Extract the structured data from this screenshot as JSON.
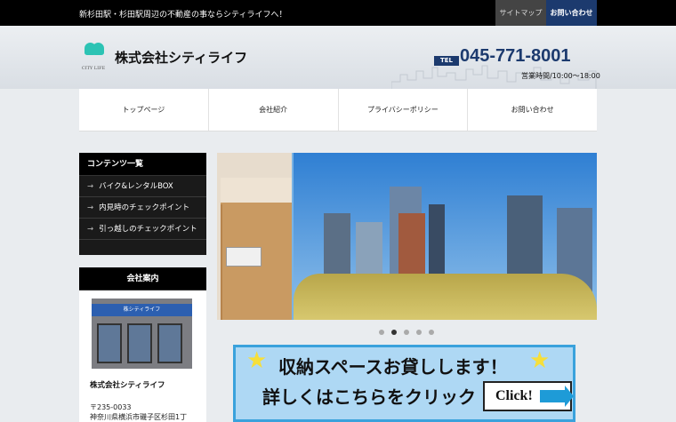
{
  "topbar": {
    "tagline": "新杉田駅・杉田駅周辺の不動産の事ならシティライフへ！",
    "sitemap": "サイトマップ",
    "contact": "お問い合わせ"
  },
  "header": {
    "logo_caption": "CITY LIFE",
    "company": "株式会社シティライフ",
    "tel_label": "TEL",
    "tel": "045-771-8001",
    "hours": "営業時間/10:00～18:00"
  },
  "nav": [
    "トップページ",
    "会社紹介",
    "プライバシーポリシー",
    "お問い合わせ"
  ],
  "sidebar": {
    "contents_title": "コンテンツ一覧",
    "contents": [
      "バイク&レンタルBOX",
      "内見時のチェックポイント",
      "引っ越しのチェックポイント"
    ],
    "company_title": "会社案内",
    "shop_sign": "株シティライフ",
    "company_name": "株式会社シティライフ",
    "zip": "〒235-0033",
    "address": "神奈川県横浜市磯子区杉田1丁"
  },
  "slider": {
    "slide_count": 5,
    "active_index": 1
  },
  "banner": {
    "line1": "収納スペースお貸しします！",
    "line2": "詳しくはこちらをクリック",
    "button": "Click!"
  },
  "colors": {
    "accent": "#1c3a6e",
    "banner_border": "#3aa2dc",
    "teal": "#2cc3b4"
  }
}
